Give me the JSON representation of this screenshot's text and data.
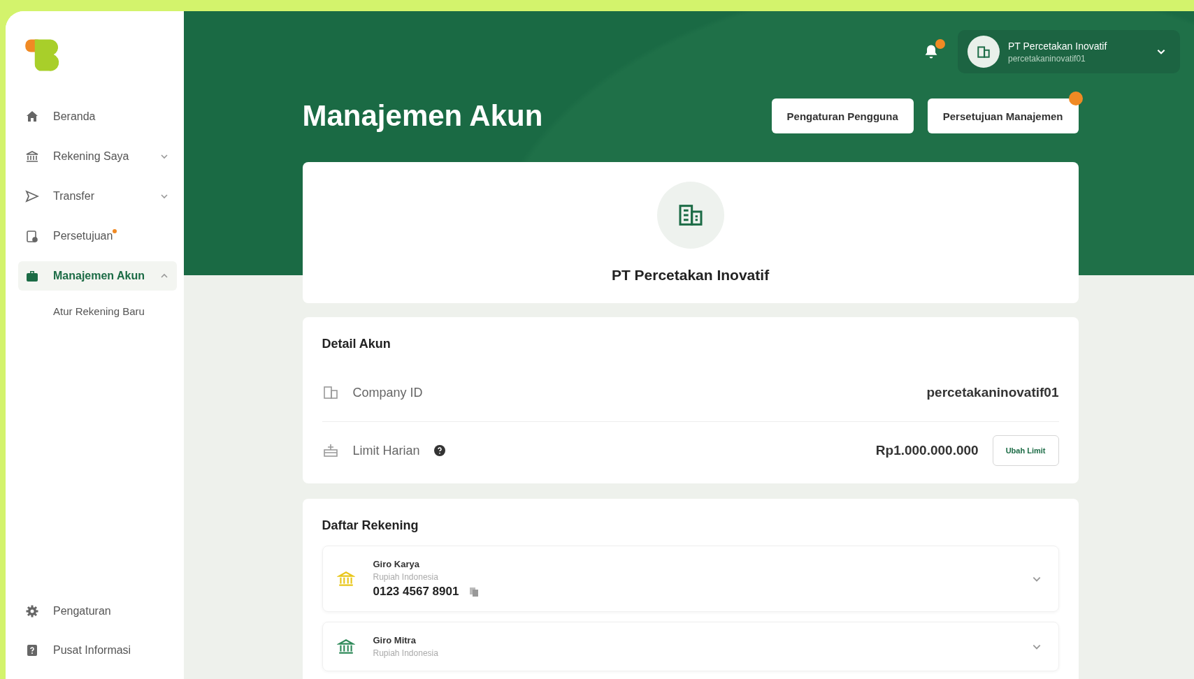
{
  "sidebar": {
    "items": [
      {
        "kind": "home",
        "label": "Beranda",
        "selected": false
      },
      {
        "kind": "bank",
        "label": "Rekening Saya",
        "selected": false,
        "expanded": false
      },
      {
        "kind": "send",
        "label": "Transfer",
        "selected": false,
        "expanded": false
      },
      {
        "kind": "approval",
        "label": "Persetujuan",
        "selected": false,
        "dot": true
      },
      {
        "kind": "briefcase",
        "label": "Manajemen Akun",
        "selected": true,
        "expanded": true,
        "children": [
          {
            "label": "Atur Rekening Baru",
            "selected": false
          }
        ]
      }
    ],
    "footer_items": [
      {
        "kind": "gear",
        "label": "Pengaturan"
      },
      {
        "kind": "help",
        "label": "Pusat Informasi"
      }
    ]
  },
  "header": {
    "notification_badge": true,
    "profile": {
      "name": "PT Percetakan Inovatif",
      "id": "percetakaninovatif01"
    }
  },
  "page": {
    "title": "Manajemen Akun",
    "buttons": [
      {
        "label": "Pengaturan Pengguna",
        "badge": false
      },
      {
        "label": "Persetujuan Manajemen",
        "badge": true
      }
    ]
  },
  "company": {
    "name": "PT Percetakan Inovatif"
  },
  "detail": {
    "title": "Detail Akun",
    "rows": [
      {
        "kind": "company",
        "label": "Company ID",
        "value": "percetakaninovatif01"
      },
      {
        "kind": "limit",
        "label": "Limit Harian",
        "value": "Rp1.000.000.000",
        "help": true,
        "action": "Ubah Limit"
      }
    ]
  },
  "accounts": {
    "title": "Daftar Rekening",
    "items": [
      {
        "name": "Giro Karya",
        "currency": "Rupiah Indonesia",
        "number": "0123 4567 8901",
        "color": "#e8c619"
      },
      {
        "name": "Giro Mitra",
        "currency": "Rupiah Indonesia",
        "color": "#2f8a5a"
      }
    ]
  }
}
